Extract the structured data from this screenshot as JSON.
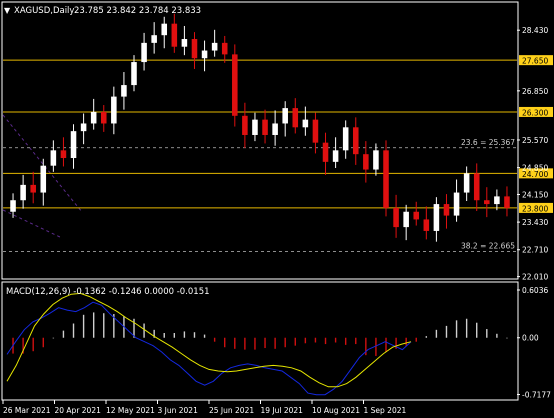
{
  "header": {
    "menu_arrow": "▼",
    "symbol": "XAGUSD,Daily",
    "ohlc": "23.785 23.842 23.784 23.833"
  },
  "colors": {
    "background": "#000000",
    "frame": "#ffffff",
    "grid": "#7a7a7a",
    "bull_candle": "#ffffff",
    "bear_candle": "#e01010",
    "level_line": "#e5b800",
    "level_label_bg": "#ffd11a",
    "fib_line": "#bdbdbd",
    "macd_line": "#1428e0",
    "signal_line": "#e6e600",
    "hist_positive": "#cfcfcf",
    "hist_negative": "#d01010",
    "trend_line": "#5a2a8a"
  },
  "chart_data": [
    {
      "type": "candlestick",
      "title": "XAGUSD,Daily",
      "ylim": [
        22.0,
        28.8
      ],
      "y_ticks": [
        "28.430",
        "27.650",
        "26.850",
        "26.300",
        "25.570",
        "24.850",
        "24.700",
        "24.150",
        "23.800",
        "23.430",
        "22.710",
        "22.010"
      ],
      "x_ticks": [
        "26 Mar 2021",
        "20 Apr 2021",
        "12 May 2021",
        "3 Jun 2021",
        "25 Jun 2021",
        "19 Jul 2021",
        "10 Aug 2021",
        "1 Sep 2021"
      ],
      "horizontal_levels": [
        27.65,
        26.3,
        24.7,
        23.8
      ],
      "horizontal_level_labels": [
        "27.650",
        "26.300",
        "24.700",
        "23.800"
      ],
      "fib_levels": [
        {
          "value": 25.367,
          "label": "23.6 = 25.367"
        },
        {
          "value": 22.665,
          "label": "38.2 = 22.665"
        }
      ],
      "close_series": [
        24.0,
        24.4,
        24.2,
        24.9,
        25.3,
        25.1,
        25.8,
        26.0,
        26.3,
        26.0,
        26.7,
        27.0,
        27.6,
        28.1,
        28.3,
        28.6,
        28.0,
        28.2,
        27.7,
        27.9,
        28.1,
        27.8,
        26.2,
        25.7,
        26.1,
        25.7,
        26.0,
        26.4,
        25.9,
        26.1,
        25.5,
        25.0,
        25.3,
        25.9,
        25.2,
        24.8,
        25.3,
        23.8,
        23.3,
        23.7,
        23.5,
        23.2,
        23.9,
        23.6,
        24.2,
        24.7,
        24.0,
        23.9,
        24.1,
        23.8
      ]
    },
    {
      "type": "line",
      "title": "MACD(12,26,9) -0.1362 -0.1246 0.0000 -0.0151",
      "ylim": [
        -0.7617,
        0.6036
      ],
      "y_ticks": [
        "0.6036",
        "0.00",
        "-0.7177"
      ],
      "histogram": [
        -0.2,
        -0.2,
        -0.17,
        -0.12,
        0.0,
        0.09,
        0.18,
        0.29,
        0.32,
        0.31,
        0.3,
        0.27,
        0.24,
        0.18,
        0.1,
        0.06,
        0.06,
        0.08,
        0.07,
        0.04,
        -0.05,
        -0.12,
        -0.14,
        -0.15,
        -0.15,
        -0.13,
        -0.14,
        -0.12,
        -0.1,
        -0.07,
        -0.06,
        -0.08,
        -0.06,
        -0.09,
        -0.08,
        -0.22,
        -0.23,
        -0.18,
        -0.14,
        -0.1,
        -0.05,
        0.02,
        0.1,
        0.15,
        0.22,
        0.24,
        0.19,
        0.11,
        0.05,
        0.0
      ],
      "series": [
        {
          "values": [
            -0.21,
            -0.05,
            0.1,
            0.2,
            0.25,
            0.31,
            0.38,
            0.35,
            0.33,
            0.38,
            0.45,
            0.41,
            0.3,
            0.2,
            0.1,
            0.0,
            -0.05,
            -0.1,
            -0.18,
            -0.28,
            -0.35,
            -0.45,
            -0.55,
            -0.6,
            -0.55,
            -0.45,
            -0.38,
            -0.35,
            -0.33,
            -0.35,
            -0.38,
            -0.4,
            -0.42,
            -0.5,
            -0.58,
            -0.7,
            -0.72,
            -0.72,
            -0.65,
            -0.55,
            -0.4,
            -0.25,
            -0.15,
            -0.1,
            -0.05,
            -0.1,
            -0.15,
            -0.05
          ]
        },
        {
          "values": [
            -0.55,
            -0.35,
            -0.1,
            0.15,
            0.3,
            0.42,
            0.5,
            0.55,
            0.56,
            0.52,
            0.46,
            0.4,
            0.33,
            0.25,
            0.18,
            0.1,
            0.02,
            -0.05,
            -0.12,
            -0.2,
            -0.28,
            -0.35,
            -0.4,
            -0.42,
            -0.43,
            -0.42,
            -0.4,
            -0.38,
            -0.36,
            -0.35,
            -0.36,
            -0.38,
            -0.42,
            -0.5,
            -0.57,
            -0.62,
            -0.62,
            -0.58,
            -0.5,
            -0.4,
            -0.3,
            -0.2,
            -0.12,
            -0.08,
            -0.05
          ]
        }
      ]
    }
  ]
}
